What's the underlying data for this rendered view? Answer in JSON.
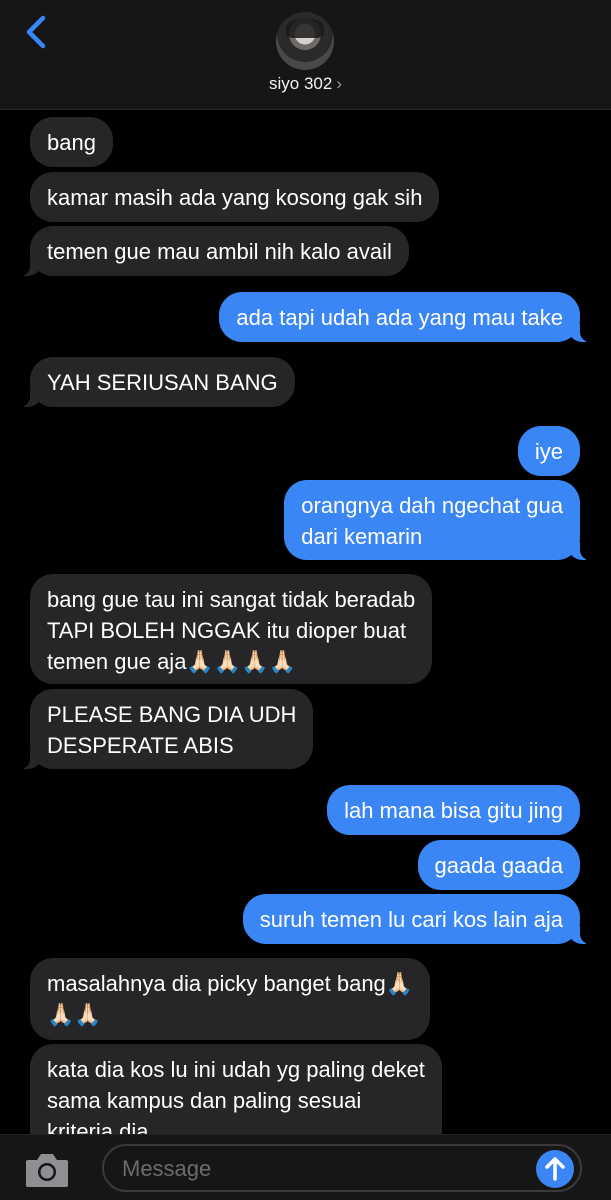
{
  "header": {
    "contact_name": "siyo 302",
    "chevron": "›",
    "back_icon": "chevron-left-icon",
    "avatar": "contact-photo"
  },
  "messages": [
    {
      "side": "in",
      "text": "bang"
    },
    {
      "side": "in",
      "text": "kamar masih ada yang kosong gak sih"
    },
    {
      "side": "in",
      "text": "temen gue mau ambil nih kalo avail"
    },
    {
      "side": "out",
      "text": "ada tapi udah ada yang mau take"
    },
    {
      "side": "in",
      "text": "YAH SERIUSAN BANG"
    },
    {
      "side": "out",
      "text": "iye"
    },
    {
      "side": "out",
      "text": "orangnya dah ngechat gua\ndari kemarin"
    },
    {
      "side": "in",
      "text": "bang gue tau ini sangat tidak beradab\nTAPI BOLEH NGGAK itu dioper buat\ntemen gue aja🙏🏻🙏🏻🙏🏻🙏🏻"
    },
    {
      "side": "in",
      "text": "PLEASE BANG DIA UDH\nDESPERATE ABIS"
    },
    {
      "side": "out",
      "text": "lah mana bisa gitu jing"
    },
    {
      "side": "out",
      "text": "gaada gaada"
    },
    {
      "side": "out",
      "text": "suruh temen lu cari kos lain aja"
    },
    {
      "side": "in",
      "text": "masalahnya dia picky banget bang🙏🏻\n🙏🏻🙏🏻"
    },
    {
      "side": "in",
      "text": "kata dia kos lu ini udah yg paling deket\nsama kampus dan paling sesuai\nkriteria dia"
    }
  ],
  "composer": {
    "placeholder": "Message",
    "camera_icon": "camera-icon",
    "send_icon": "arrow-up-icon"
  },
  "colors": {
    "incoming_bubble": "#262628",
    "outgoing_bubble": "#3a86f5",
    "background": "#000000",
    "header": "#161616"
  }
}
